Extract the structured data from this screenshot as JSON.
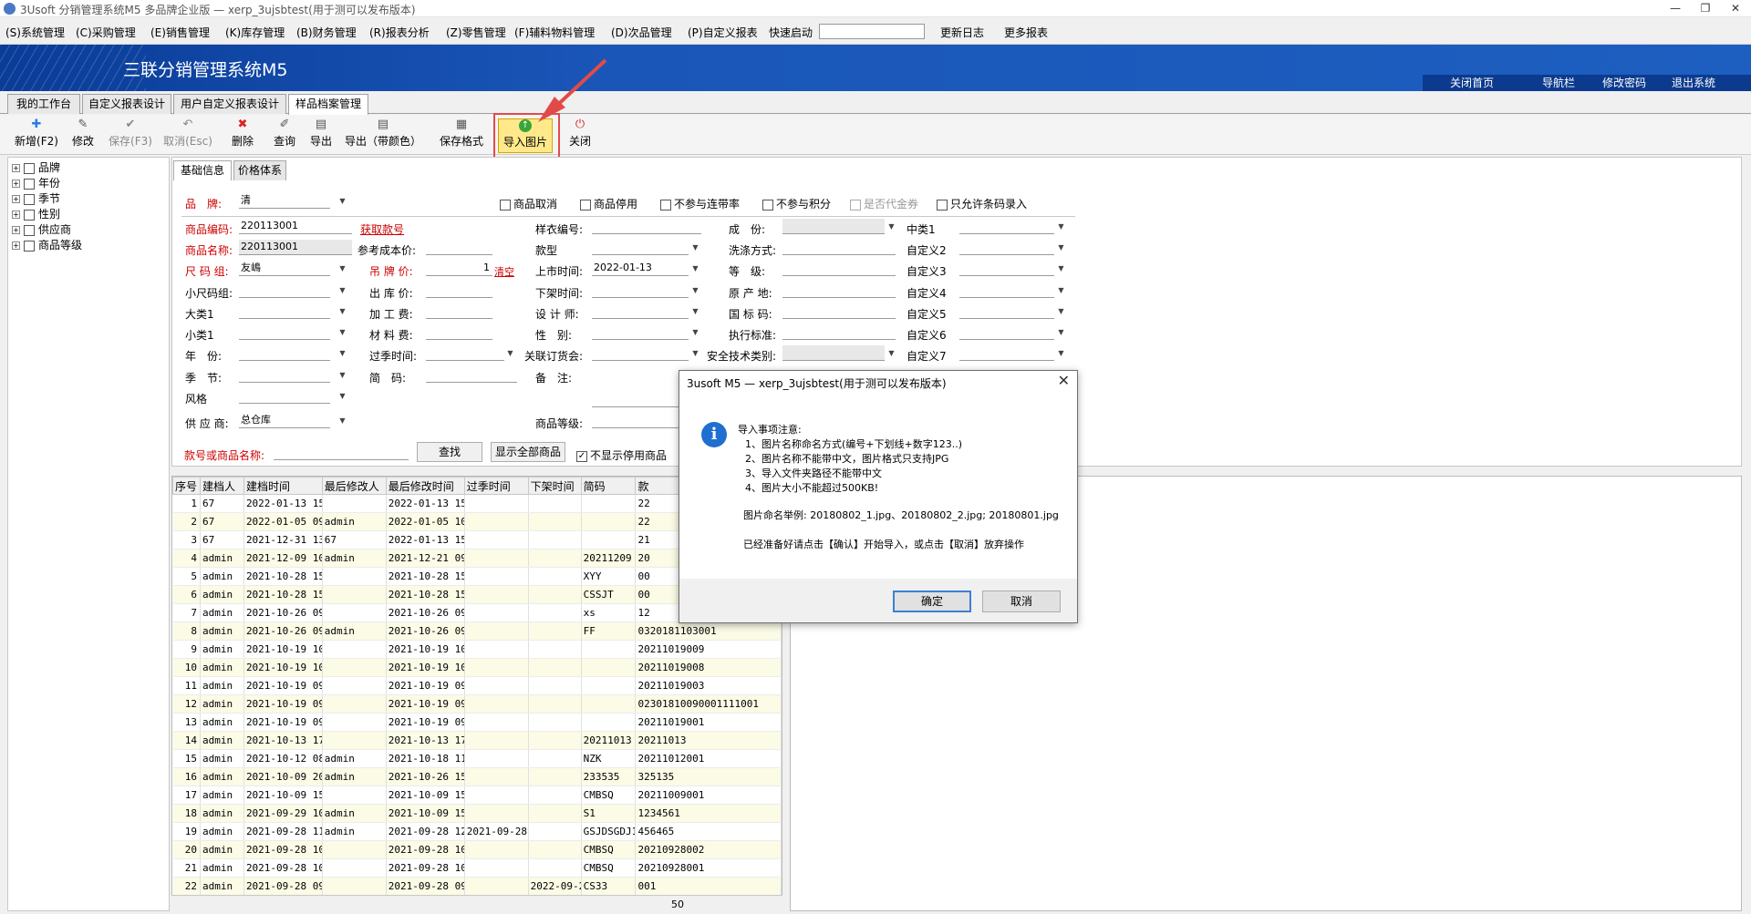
{
  "window": {
    "title": "3Usoft 分销管理系统M5 多品牌企业版 — xerp_3ujsbtest(用于测可以发布版本)",
    "min": "—",
    "restore": "❐",
    "close": "✕"
  },
  "menu": {
    "items": [
      "(S)系统管理",
      "(C)采购管理",
      "(E)销售管理",
      "(K)库存管理",
      "(B)财务管理",
      "(R)报表分析",
      "(Z)零售管理",
      "(F)辅料物料管理",
      "(D)次品管理",
      "(P)自定义报表"
    ],
    "quick": "快速启动",
    "update": "更新日志",
    "more": "更多报表"
  },
  "banner": {
    "title": "三联分销管理系统M5",
    "links": [
      "关闭首页",
      "导航栏",
      "修改密码",
      "退出系统"
    ]
  },
  "tabs": [
    "我的工作台",
    "自定义报表设计",
    "用户自定义报表设计",
    "样品档案管理"
  ],
  "toolbar": {
    "new": "新增(F2)",
    "edit": "修改",
    "save": "保存(F3)",
    "cancel": "取消(Esc)",
    "delete": "删除",
    "query": "查询",
    "export": "导出",
    "export_color": "导出（带颜色）",
    "save_format": "保存格式",
    "import_image": "导入图片",
    "close": "关闭"
  },
  "tree": [
    "品牌",
    "年份",
    "季节",
    "性别",
    "供应商",
    "商品等级"
  ],
  "subtabs": [
    "基础信息",
    "价格体系"
  ],
  "form": {
    "brand_label": "品　牌:",
    "brand_value": "清",
    "checks": {
      "cancel": "商品取消",
      "disable": "商品停用",
      "no_bundle": "不参与连带率",
      "no_points": "不参与积分",
      "voucher": "是否代金券",
      "barcode_only": "只允许条码录入"
    },
    "code_label": "商品编码:",
    "code_value": "220113001",
    "get_style": "获取款号",
    "name_label": "商品名称:",
    "name_value": "220113001",
    "size_group_label": "尺 码 组:",
    "size_group_value": "友嶋",
    "small_size_label": "小尺码组:",
    "cat1_label": "大类1",
    "cat_small_label": "小类1",
    "year_label": "年　份:",
    "season_label": "季　节:",
    "style_label": "风格",
    "supplier_label": "供 应 商:",
    "supplier_value": "总仓库",
    "ref_cost_label": "参考成本价:",
    "tag_price_label": "吊 牌 价:",
    "tag_price_value": "1",
    "clear": "清空",
    "out_price_label": "出 库 价:",
    "process_fee_label": "加 工 费:",
    "material_fee_label": "材 料 费:",
    "season_time_label": "过季时间:",
    "short_code_label": "简　码:",
    "sample_no_label": "样衣编号:",
    "style_type_label": "款型",
    "launch_label": "上市时间:",
    "launch_value": "2022-01-13",
    "offshelf_label": "下架时间:",
    "designer_label": "设 计 师:",
    "gender_label": "性　别:",
    "order_label": "关联订货会:",
    "remark_label": "备　注:",
    "grade_label": "商品等级:",
    "composition_label": "成　份:",
    "wash_label": "洗涤方式:",
    "level_label": "等　级:",
    "origin_label": "原 产 地:",
    "national_label": "国 标 码:",
    "standard_label": "执行标准:",
    "safety_label": "安全技术类别:",
    "mid1_label": "中类1",
    "custom2": "自定义2",
    "custom3": "自定义3",
    "custom4": "自定义4",
    "custom5": "自定义5",
    "custom6": "自定义6",
    "custom7": "自定义7",
    "search_label": "款号或商品名称:",
    "find_btn": "查找",
    "show_all_btn": "显示全部商品",
    "hide_disabled": "不显示停用商品"
  },
  "grid": {
    "headers": [
      "序号",
      "建档人",
      "建档时间",
      "最后修改人",
      "最后修改时间",
      "过季时间",
      "下架时间",
      "简码",
      "款"
    ],
    "rows": [
      [
        "1",
        "67",
        "2022-01-13 15",
        "",
        "2022-01-13 15:",
        "",
        "",
        "",
        "22"
      ],
      [
        "2",
        "67",
        "2022-01-05 09",
        "admin",
        "2022-01-05 10:",
        "",
        "",
        "",
        "22"
      ],
      [
        "3",
        "67",
        "2021-12-31 13",
        "67",
        "2022-01-13 15:",
        "",
        "",
        "",
        "21"
      ],
      [
        "4",
        "admin",
        "2021-12-09 10",
        "admin",
        "2021-12-21 09:",
        "",
        "",
        "20211209",
        "20"
      ],
      [
        "5",
        "admin",
        "2021-10-28 15",
        "",
        "2021-10-28 15:",
        "",
        "",
        "XYY",
        "00"
      ],
      [
        "6",
        "admin",
        "2021-10-28 15",
        "",
        "2021-10-28 15:",
        "",
        "",
        "CSSJT",
        "00"
      ],
      [
        "7",
        "admin",
        "2021-10-26 09",
        "",
        "2021-10-26 09:",
        "",
        "",
        "xs",
        "12"
      ],
      [
        "8",
        "admin",
        "2021-10-26 09",
        "admin",
        "2021-10-26 09:",
        "",
        "",
        "FF",
        "0320181103001"
      ],
      [
        "9",
        "admin",
        "2021-10-19 10",
        "",
        "2021-10-19 10:",
        "",
        "",
        "",
        "20211019009"
      ],
      [
        "10",
        "admin",
        "2021-10-19 10",
        "",
        "2021-10-19 10:",
        "",
        "",
        "",
        "20211019008"
      ],
      [
        "11",
        "admin",
        "2021-10-19 09",
        "",
        "2021-10-19 09:",
        "",
        "",
        "",
        "20211019003"
      ],
      [
        "12",
        "admin",
        "2021-10-19 09",
        "",
        "2021-10-19 09:",
        "",
        "",
        "",
        "02301810090001111001"
      ],
      [
        "13",
        "admin",
        "2021-10-19 09",
        "",
        "2021-10-19 09:",
        "",
        "",
        "",
        "20211019001"
      ],
      [
        "14",
        "admin",
        "2021-10-13 17",
        "",
        "2021-10-13 17:",
        "",
        "",
        "20211013",
        "20211013"
      ],
      [
        "15",
        "admin",
        "2021-10-12 08",
        "admin",
        "2021-10-18 11:",
        "",
        "",
        "NZK",
        "20211012001"
      ],
      [
        "16",
        "admin",
        "2021-10-09 20",
        "admin",
        "2021-10-26 15:",
        "",
        "",
        "233535",
        "325135"
      ],
      [
        "17",
        "admin",
        "2021-10-09 15",
        "",
        "2021-10-09 15:",
        "",
        "",
        "CMBSQ",
        "20211009001"
      ],
      [
        "18",
        "admin",
        "2021-09-29 10",
        "admin",
        "2021-10-09 15:",
        "",
        "",
        "S1",
        "1234561"
      ],
      [
        "19",
        "admin",
        "2021-09-28 11",
        "admin",
        "2021-09-28 12:",
        "2021-09-28",
        "",
        "GSJDSGDJ1",
        "456465"
      ],
      [
        "20",
        "admin",
        "2021-09-28 10",
        "",
        "2021-09-28 10:",
        "",
        "",
        "CMBSQ",
        "20210928002"
      ],
      [
        "21",
        "admin",
        "2021-09-28 10",
        "",
        "2021-09-28 10:",
        "",
        "",
        "CMBSQ",
        "20210928001"
      ],
      [
        "22",
        "admin",
        "2021-09-28 09",
        "",
        "2021-09-28 09:",
        "",
        "2022-09-2",
        "CS33",
        "001"
      ]
    ],
    "footer_count": "50"
  },
  "dialog": {
    "title": "3usoft M5 — xerp_3ujsbtest(用于测可以发布版本)",
    "close": "✕",
    "icon": "i",
    "lines": [
      "导入事项注意:",
      "1、图片名称命名方式(编号+下划线+数字123..)",
      "2、图片名称不能带中文，图片格式只支持JPG",
      "3、导入文件夹路径不能带中文",
      "4、图片大小不能超过500KB!"
    ],
    "example": "图片命名举例: 20180802_1.jpg、20180802_2.jpg; 20180801.jpg",
    "prompt": "已经准备好请点击【确认】开始导入，或点击【取消】放弃操作",
    "ok": "确定",
    "cancel": "取消"
  },
  "colors": {
    "banner": "#1d5fc0",
    "highlight": "#ffe98a",
    "annotation": "#e24a4a",
    "required": "#cc0000"
  }
}
